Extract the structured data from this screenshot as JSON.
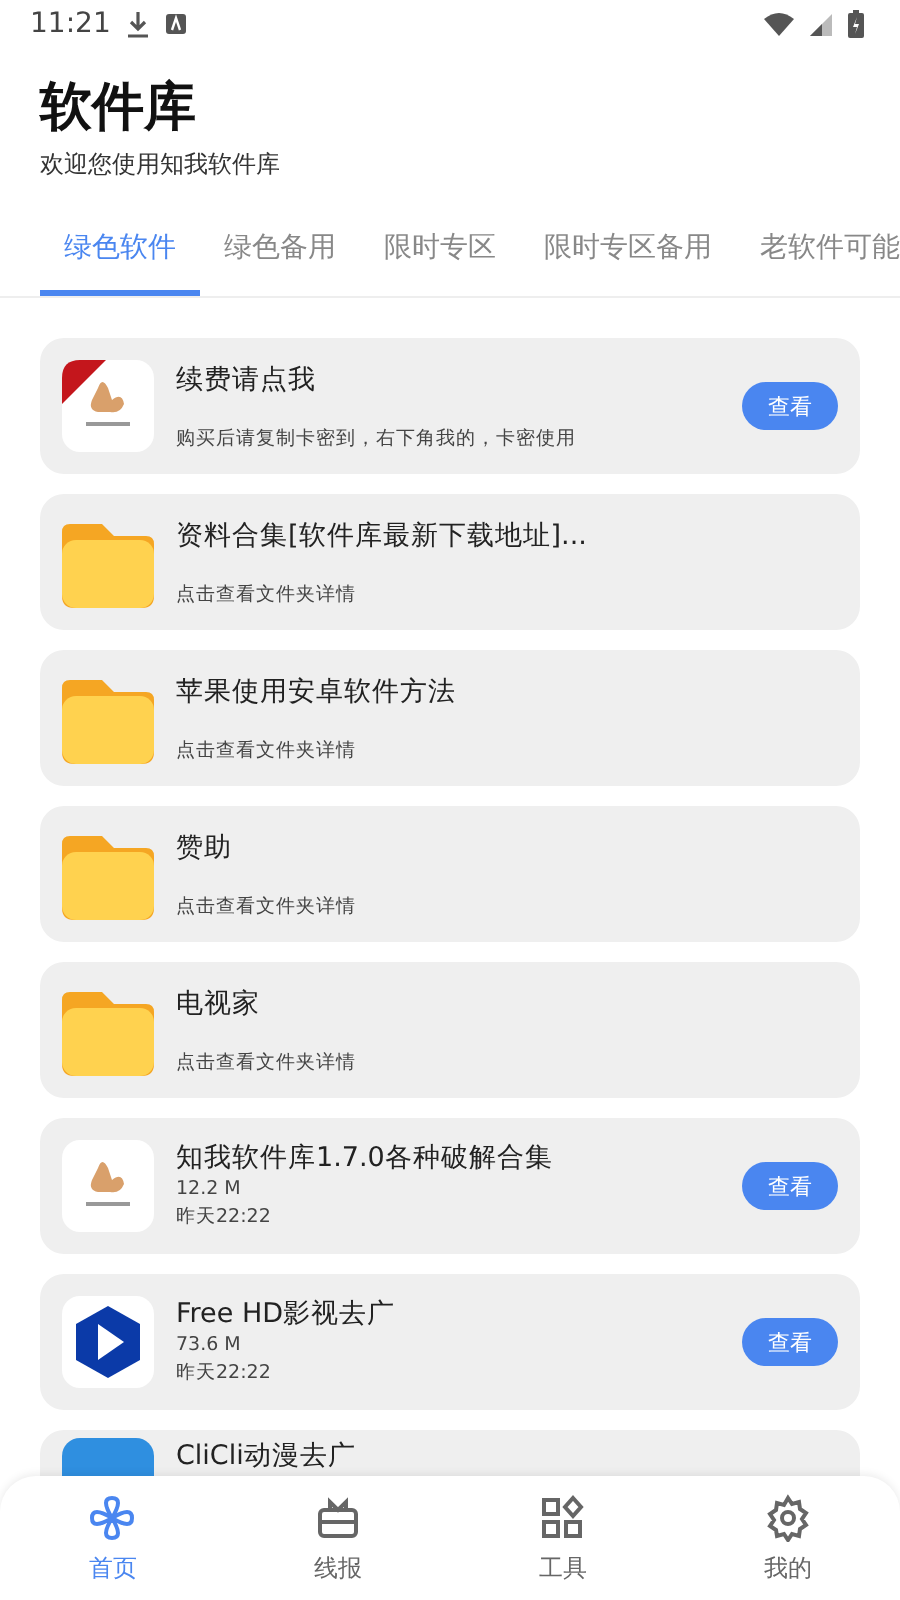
{
  "status_bar": {
    "time": "11:21"
  },
  "header": {
    "title": "软件库",
    "subtitle": "欢迎您使用知我软件库"
  },
  "tabs": [
    {
      "label": "绿色软件",
      "selected": true
    },
    {
      "label": "绿色备用",
      "selected": false
    },
    {
      "label": "限时专区",
      "selected": false
    },
    {
      "label": "限时专区备用",
      "selected": false
    },
    {
      "label": "老软件可能",
      "selected": false
    }
  ],
  "items": [
    {
      "kind": "pinned",
      "title": "续费请点我",
      "desc": "购买后请复制卡密到，右下角我的，卡密使用",
      "button": "查看"
    },
    {
      "kind": "folder",
      "title": "资料合集[软件库最新下载地址]...",
      "desc": "点击查看文件夹详情"
    },
    {
      "kind": "folder",
      "title": "苹果使用安卓软件方法",
      "desc": "点击查看文件夹详情"
    },
    {
      "kind": "folder",
      "title": "赞助",
      "desc": "点击查看文件夹详情"
    },
    {
      "kind": "folder",
      "title": "电视家",
      "desc": "点击查看文件夹详情"
    },
    {
      "kind": "archive",
      "title": "知我软件库1.7.0各种破解合集",
      "size": "12.2 M",
      "date": "昨天22:22",
      "button": "查看"
    },
    {
      "kind": "video",
      "title": "Free HD影视去广",
      "size": "73.6 M",
      "date": "昨天22:22",
      "button": "查看"
    },
    {
      "kind": "partial",
      "title": "CliCli动漫去广"
    }
  ],
  "bottom_nav": [
    {
      "label": "首页",
      "selected": true
    },
    {
      "label": "线报",
      "selected": false
    },
    {
      "label": "工具",
      "selected": false
    },
    {
      "label": "我的",
      "selected": false
    }
  ]
}
